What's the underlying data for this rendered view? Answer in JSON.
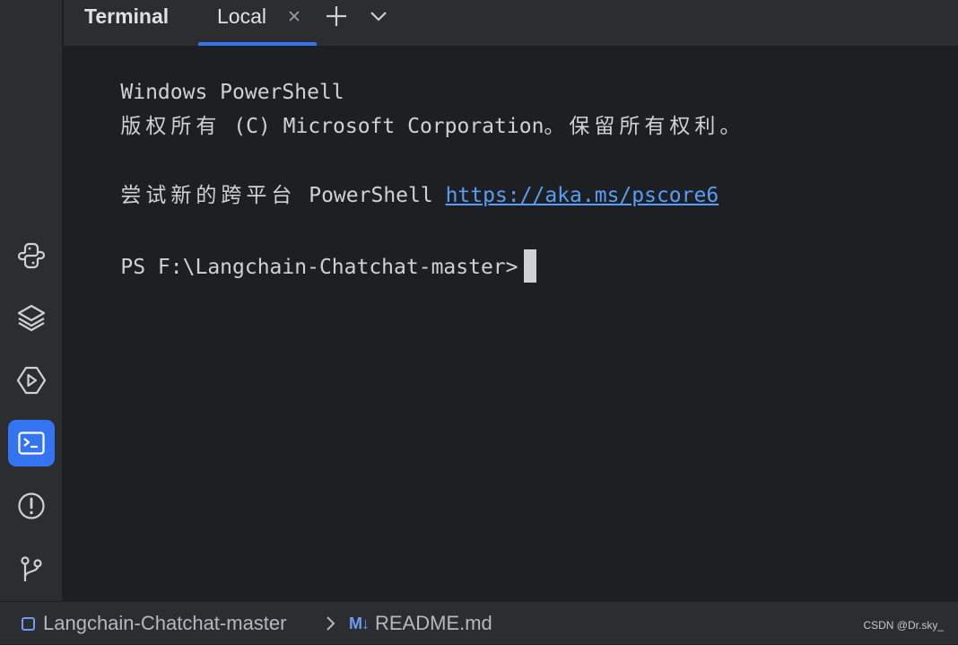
{
  "sidebar": {
    "items": [
      {
        "icon": "python-console-icon",
        "active": false
      },
      {
        "icon": "layers-icon",
        "active": false
      },
      {
        "icon": "services-icon",
        "active": false
      },
      {
        "icon": "terminal-icon",
        "active": true
      },
      {
        "icon": "problems-icon",
        "active": false
      },
      {
        "icon": "git-icon",
        "active": false
      }
    ]
  },
  "tabbar": {
    "tool_title": "Terminal",
    "tabs": [
      {
        "label": "Local",
        "active": true
      }
    ],
    "add_icon": "plus-icon",
    "menu_icon": "chevron-down-icon"
  },
  "terminal": {
    "line1": "Windows PowerShell",
    "line2_cjk_a": "版权所有",
    "line2_mid": " (C) Microsoft Corporation",
    "line2_cjk_b": "。保留所有权利。",
    "line4_cjk": "尝试新的跨平台",
    "line4_text": " PowerShell ",
    "line4_link": "https://aka.ms/pscore6",
    "prompt": "PS F:\\Langchain-Chatchat-master>"
  },
  "statusbar": {
    "project": "Langchain-Chatchat-master",
    "file_icon": "M↓",
    "file": "README.md",
    "watermark": "CSDN @Dr.sky_"
  },
  "colors": {
    "accent": "#3574f0",
    "link": "#589df6",
    "background": "#1e1f22",
    "panel": "#2b2d30"
  }
}
